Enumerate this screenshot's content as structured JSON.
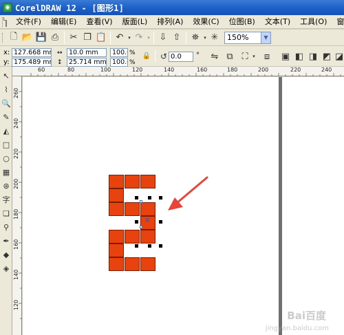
{
  "window": {
    "title": "CorelDRAW 12 - [图形1]"
  },
  "menu": [
    {
      "label": "文件(F)"
    },
    {
      "label": "编辑(E)"
    },
    {
      "label": "查看(V)"
    },
    {
      "label": "版面(L)"
    },
    {
      "label": "排列(A)"
    },
    {
      "label": "效果(C)"
    },
    {
      "label": "位图(B)"
    },
    {
      "label": "文本(T)"
    },
    {
      "label": "工具(O)"
    },
    {
      "label": "窗口"
    }
  ],
  "standard_toolbar": {
    "zoom_value": "150%",
    "buttons": [
      "new-icon",
      "open-icon",
      "save-icon",
      "print-icon",
      "cut-icon",
      "copy-icon",
      "paste-icon",
      "undo-icon",
      "redo-icon",
      "import-icon",
      "export-icon",
      "launch-icon",
      "corel-online-icon"
    ]
  },
  "property_bar": {
    "x_label": "x:",
    "x_value": "127.668 mm",
    "y_label": "y:",
    "y_value": "175.489 mm",
    "width_value": "10.0 mm",
    "height_value": "25.714 mm",
    "scale_x": "100.0",
    "scale_y": "100.0",
    "percent_x": "%",
    "percent_y": "%",
    "rotation_value": "0.0",
    "degree_symbol": "°"
  },
  "rulers": {
    "horizontal_ticks": [
      "60",
      "80",
      "100",
      "120",
      "140",
      "160",
      "180",
      "200",
      "220",
      "240"
    ],
    "vertical_ticks": [
      "260",
      "240",
      "220",
      "200",
      "180",
      "160",
      "140",
      "120"
    ]
  },
  "colors": {
    "accent_fill": "#e8430f",
    "titlebar": "#1c5fc6",
    "arrow": "#e8443a"
  },
  "watermark": {
    "text": "Bai百度",
    "sub": "jingyan.baidu.com"
  }
}
